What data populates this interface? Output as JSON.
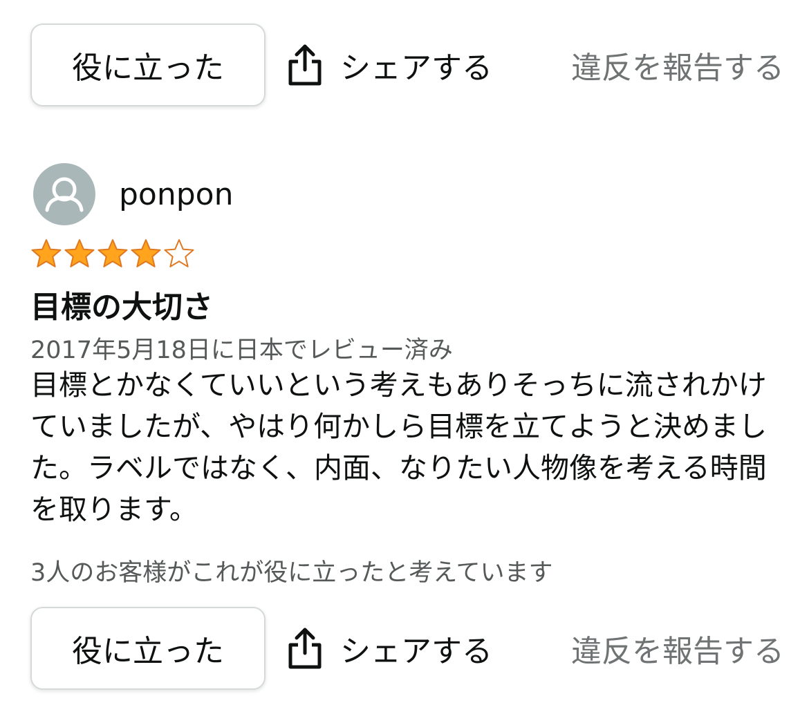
{
  "top_actions": {
    "helpful_label": "役に立った",
    "share_label": "シェアする",
    "report_label": "違反を報告する"
  },
  "review": {
    "reviewer_name": "ponpon",
    "rating": 4,
    "rating_max": 5,
    "title": "目標の大切さ",
    "date_line": "2017年5月18日に日本でレビュー済み",
    "body": "目標とかなくていいという考えもありそっちに流されかけていましたが、やはり何かしら目標を立てようと決めました。ラベルではなく、内面、なりたい人物像を考える時間を取ります。",
    "helpful_count_text": "3人のお客様がこれが役に立ったと考えています",
    "actions": {
      "helpful_label": "役に立った",
      "share_label": "シェアする",
      "report_label": "違反を報告する"
    }
  },
  "colors": {
    "star_fill": "#ffa41c",
    "star_stroke": "#de7921",
    "avatar_bg": "#aab7b8",
    "secondary_text": "#565959",
    "button_border": "#d5d9d9"
  },
  "icons": {
    "share": "share-icon",
    "avatar": "user-silhouette-icon",
    "star": "star-icon"
  }
}
